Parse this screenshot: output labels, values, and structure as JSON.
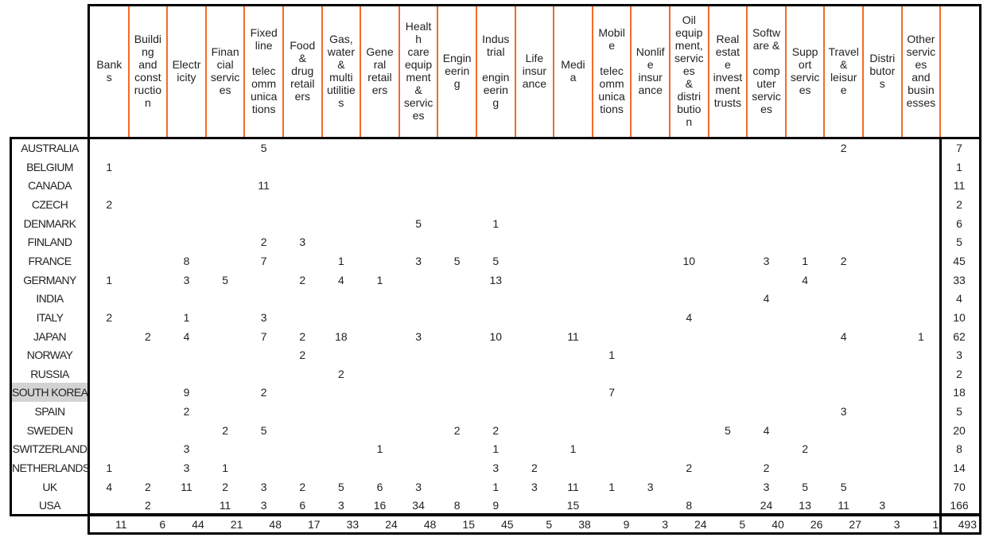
{
  "columns": [
    "Bank\ns",
    "Buildi\nng\nand\nconst\nructio\nn",
    "Electr\nicity",
    "Finan\ncial\nservic\nes",
    "Fixed\nline\n\ntelec\nomm\nunica\ntions",
    "Food\n&\ndrug\nretail\ners",
    "Gas,\nwater\n&\nmulti\nutilitie\ns",
    "Gene\nral\nretail\ners",
    "Healt\nh\ncare\nequip\nment\n&\nservic\nes",
    "Engin\neerin\ng",
    "Indus\ntrial\n\nengin\neerin\ng",
    "Life\ninsur\nance",
    "Medi\na",
    "Mobil\ne\n\ntelec\nomm\nunica\ntions",
    "Nonlif\ne\ninsur\nance",
    "Oil\nequip\nment,\nservic\nes\n&\ndistri\nbutio\nn",
    "Real\nestat\ne\ninvest\nment\ntrusts",
    "Softw\nare &\n\ncomp\nuter\nservic\nes",
    "Supp\nort\nservic\nes",
    "Travel\n&\nleisur\ne",
    "Distri\nbutor\ns",
    "Other\nservic\nes\nand\nbusin\nesses"
  ],
  "highlighted_row": "SOUTH KOREA",
  "colors": {
    "column_divider": "#f26b2a",
    "highlight": "#d3d3d3",
    "border": "#000000"
  },
  "rows": [
    {
      "country": "AUSTRALIA",
      "values": [
        "",
        "",
        "",
        "",
        "5",
        "",
        "",
        "",
        "",
        "",
        "",
        "",
        "",
        "",
        "",
        "",
        "",
        "",
        "",
        "2",
        "",
        ""
      ],
      "total": "7"
    },
    {
      "country": "BELGIUM",
      "values": [
        "1",
        "",
        "",
        "",
        "",
        "",
        "",
        "",
        "",
        "",
        "",
        "",
        "",
        "",
        "",
        "",
        "",
        "",
        "",
        "",
        "",
        ""
      ],
      "total": "1"
    },
    {
      "country": "CANADA",
      "values": [
        "",
        "",
        "",
        "",
        "11",
        "",
        "",
        "",
        "",
        "",
        "",
        "",
        "",
        "",
        "",
        "",
        "",
        "",
        "",
        "",
        "",
        ""
      ],
      "total": "11"
    },
    {
      "country": "CZECH",
      "values": [
        "2",
        "",
        "",
        "",
        "",
        "",
        "",
        "",
        "",
        "",
        "",
        "",
        "",
        "",
        "",
        "",
        "",
        "",
        "",
        "",
        "",
        ""
      ],
      "total": "2"
    },
    {
      "country": "DENMARK",
      "values": [
        "",
        "",
        "",
        "",
        "",
        "",
        "",
        "",
        "5",
        "",
        "1",
        "",
        "",
        "",
        "",
        "",
        "",
        "",
        "",
        "",
        "",
        ""
      ],
      "total": "6"
    },
    {
      "country": "FINLAND",
      "values": [
        "",
        "",
        "",
        "",
        "2",
        "3",
        "",
        "",
        "",
        "",
        "",
        "",
        "",
        "",
        "",
        "",
        "",
        "",
        "",
        "",
        "",
        ""
      ],
      "total": "5"
    },
    {
      "country": "FRANCE",
      "values": [
        "",
        "",
        "8",
        "",
        "7",
        "",
        "1",
        "",
        "3",
        "5",
        "5",
        "",
        "",
        "",
        "",
        "10",
        "",
        "3",
        "1",
        "2",
        "",
        ""
      ],
      "total": "45"
    },
    {
      "country": "GERMANY",
      "values": [
        "1",
        "",
        "3",
        "5",
        "",
        "2",
        "4",
        "1",
        "",
        "",
        "13",
        "",
        "",
        "",
        "",
        "",
        "",
        "",
        "4",
        "",
        "",
        ""
      ],
      "total": "33"
    },
    {
      "country": "INDIA",
      "values": [
        "",
        "",
        "",
        "",
        "",
        "",
        "",
        "",
        "",
        "",
        "",
        "",
        "",
        "",
        "",
        "",
        "",
        "4",
        "",
        "",
        "",
        ""
      ],
      "total": "4"
    },
    {
      "country": "ITALY",
      "values": [
        "2",
        "",
        "1",
        "",
        "3",
        "",
        "",
        "",
        "",
        "",
        "",
        "",
        "",
        "",
        "",
        "4",
        "",
        "",
        "",
        "",
        "",
        ""
      ],
      "total": "10"
    },
    {
      "country": "JAPAN",
      "values": [
        "",
        "2",
        "4",
        "",
        "7",
        "2",
        "18",
        "",
        "3",
        "",
        "10",
        "",
        "11",
        "",
        "",
        "",
        "",
        "",
        "",
        "4",
        "",
        "1"
      ],
      "total": "62"
    },
    {
      "country": "NORWAY",
      "values": [
        "",
        "",
        "",
        "",
        "",
        "2",
        "",
        "",
        "",
        "",
        "",
        "",
        "",
        "1",
        "",
        "",
        "",
        "",
        "",
        "",
        "",
        ""
      ],
      "total": "3"
    },
    {
      "country": "RUSSIA",
      "values": [
        "",
        "",
        "",
        "",
        "",
        "",
        "2",
        "",
        "",
        "",
        "",
        "",
        "",
        "",
        "",
        "",
        "",
        "",
        "",
        "",
        "",
        ""
      ],
      "total": "2"
    },
    {
      "country": "SOUTH KOREA",
      "values": [
        "",
        "",
        "9",
        "",
        "2",
        "",
        "",
        "",
        "",
        "",
        "",
        "",
        "",
        "7",
        "",
        "",
        "",
        "",
        "",
        "",
        "",
        ""
      ],
      "total": "18"
    },
    {
      "country": "SPAIN",
      "values": [
        "",
        "",
        "2",
        "",
        "",
        "",
        "",
        "",
        "",
        "",
        "",
        "",
        "",
        "",
        "",
        "",
        "",
        "",
        "",
        "3",
        "",
        ""
      ],
      "total": "5"
    },
    {
      "country": "SWEDEN",
      "values": [
        "",
        "",
        "",
        "2",
        "5",
        "",
        "",
        "",
        "",
        "2",
        "2",
        "",
        "",
        "",
        "",
        "",
        "5",
        "4",
        "",
        "",
        "",
        ""
      ],
      "total": "20"
    },
    {
      "country": "SWITZERLAND",
      "values": [
        "",
        "",
        "3",
        "",
        "",
        "",
        "",
        "1",
        "",
        "",
        "1",
        "",
        "1",
        "",
        "",
        "",
        "",
        "",
        "2",
        "",
        "",
        ""
      ],
      "total": "8"
    },
    {
      "country": "NETHERLANDS",
      "values": [
        "1",
        "",
        "3",
        "1",
        "",
        "",
        "",
        "",
        "",
        "",
        "3",
        "2",
        "",
        "",
        "",
        "2",
        "",
        "2",
        "",
        "",
        "",
        ""
      ],
      "total": "14"
    },
    {
      "country": "UK",
      "values": [
        "4",
        "2",
        "11",
        "2",
        "3",
        "2",
        "5",
        "6",
        "3",
        "",
        "1",
        "3",
        "11",
        "1",
        "3",
        "",
        "",
        "3",
        "5",
        "5",
        "",
        ""
      ],
      "total": "70"
    },
    {
      "country": "USA",
      "values": [
        "",
        "2",
        "",
        "11",
        "3",
        "6",
        "3",
        "16",
        "34",
        "8",
        "9",
        "",
        "15",
        "",
        "",
        "8",
        "",
        "24",
        "13",
        "11",
        "3",
        ""
      ],
      "total": "166"
    }
  ],
  "column_totals": [
    "11",
    "6",
    "44",
    "21",
    "48",
    "17",
    "33",
    "24",
    "48",
    "15",
    "45",
    "5",
    "38",
    "9",
    "3",
    "24",
    "5",
    "40",
    "26",
    "27",
    "3",
    "1"
  ],
  "grand_total": "493"
}
